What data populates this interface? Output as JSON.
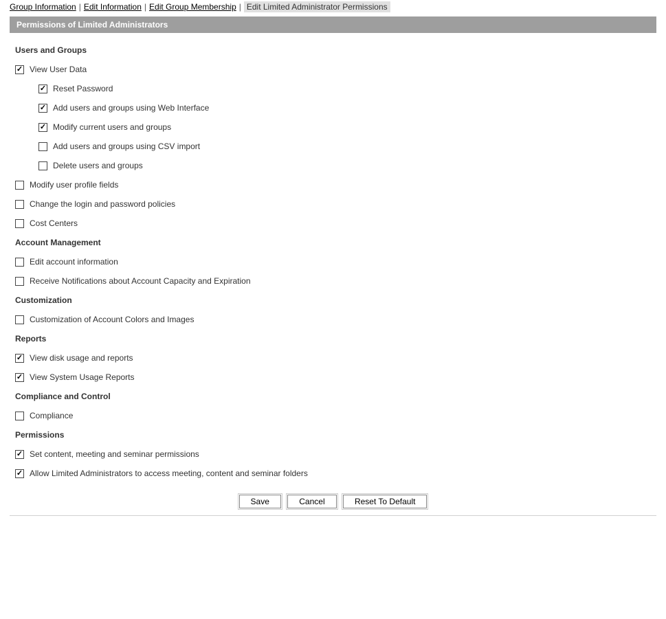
{
  "tabs": {
    "items": [
      {
        "label": "Group Information",
        "active": false
      },
      {
        "label": "Edit Information",
        "active": false
      },
      {
        "label": "Edit Group Membership",
        "active": false
      },
      {
        "label": "Edit Limited Administrator Permissions",
        "active": true
      }
    ]
  },
  "section_title": "Permissions of Limited Administrators",
  "groups": [
    {
      "heading": "Users and Groups",
      "items": [
        {
          "label": "View User Data",
          "checked": true,
          "children": [
            {
              "label": "Reset Password",
              "checked": true
            },
            {
              "label": "Add users and groups using Web Interface",
              "checked": true
            },
            {
              "label": "Modify current users and groups",
              "checked": true
            },
            {
              "label": "Add users and groups using CSV import",
              "checked": false
            },
            {
              "label": "Delete users and groups",
              "checked": false
            }
          ]
        },
        {
          "label": "Modify user profile fields",
          "checked": false
        },
        {
          "label": "Change the login and password policies",
          "checked": false
        },
        {
          "label": "Cost Centers",
          "checked": false
        }
      ]
    },
    {
      "heading": "Account Management",
      "items": [
        {
          "label": "Edit account information",
          "checked": false
        },
        {
          "label": "Receive Notifications about Account Capacity and Expiration",
          "checked": false
        }
      ]
    },
    {
      "heading": "Customization",
      "items": [
        {
          "label": "Customization of Account Colors and Images",
          "checked": false
        }
      ]
    },
    {
      "heading": "Reports",
      "items": [
        {
          "label": "View disk usage and reports",
          "checked": true
        },
        {
          "label": "View System Usage Reports",
          "checked": true
        }
      ]
    },
    {
      "heading": "Compliance and Control",
      "items": [
        {
          "label": "Compliance",
          "checked": false
        }
      ]
    },
    {
      "heading": "Permissions",
      "items": [
        {
          "label": "Set content, meeting and seminar permissions",
          "checked": true
        },
        {
          "label": "Allow Limited Administrators to access meeting, content and seminar folders",
          "checked": true
        }
      ]
    }
  ],
  "buttons": {
    "save": "Save",
    "cancel": "Cancel",
    "reset": "Reset To Default"
  }
}
